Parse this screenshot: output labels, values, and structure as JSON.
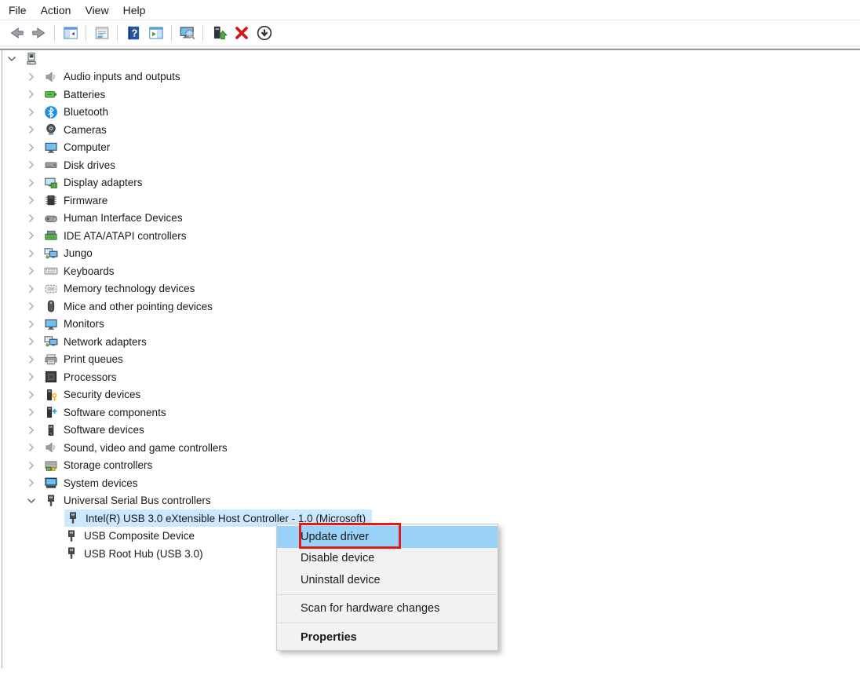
{
  "menubar": {
    "items": [
      {
        "label": "File"
      },
      {
        "label": "Action"
      },
      {
        "label": "View"
      },
      {
        "label": "Help"
      }
    ]
  },
  "toolbar": {
    "buttons": [
      {
        "type": "button",
        "name": "back",
        "icon": "back-arrow"
      },
      {
        "type": "button",
        "name": "forward",
        "icon": "forward-arrow"
      },
      {
        "type": "sep"
      },
      {
        "type": "button",
        "name": "show-console-tree",
        "icon": "console-tree"
      },
      {
        "type": "sep"
      },
      {
        "type": "button",
        "name": "properties",
        "icon": "properties-window"
      },
      {
        "type": "sep"
      },
      {
        "type": "button",
        "name": "help",
        "icon": "help-book"
      },
      {
        "type": "button",
        "name": "show-action-pane",
        "icon": "action-pane"
      },
      {
        "type": "sep"
      },
      {
        "type": "button",
        "name": "scan-for-hardware-changes",
        "icon": "scan-computer"
      },
      {
        "type": "sep"
      },
      {
        "type": "button",
        "name": "update-driver",
        "icon": "device-up-arrow"
      },
      {
        "type": "button",
        "name": "uninstall-device",
        "icon": "red-x"
      },
      {
        "type": "button",
        "name": "disable-device",
        "icon": "circle-down-arrow"
      }
    ]
  },
  "tree": {
    "rows": [
      {
        "label": "",
        "icon": "computer-root",
        "chevron": "down",
        "level": 0
      },
      {
        "label": "Audio inputs and outputs",
        "icon": "speaker",
        "chevron": "right",
        "level": 1
      },
      {
        "label": "Batteries",
        "icon": "battery",
        "chevron": "right",
        "level": 1
      },
      {
        "label": "Bluetooth",
        "icon": "bluetooth",
        "chevron": "right",
        "level": 1
      },
      {
        "label": "Cameras",
        "icon": "camera",
        "chevron": "right",
        "level": 1
      },
      {
        "label": "Computer",
        "icon": "monitor",
        "chevron": "right",
        "level": 1
      },
      {
        "label": "Disk drives",
        "icon": "disk",
        "chevron": "right",
        "level": 1
      },
      {
        "label": "Display adapters",
        "icon": "display-adapter",
        "chevron": "right",
        "level": 1
      },
      {
        "label": "Firmware",
        "icon": "firmware-chip",
        "chevron": "right",
        "level": 1
      },
      {
        "label": "Human Interface Devices",
        "icon": "gamepad",
        "chevron": "right",
        "level": 1
      },
      {
        "label": "IDE ATA/ATAPI controllers",
        "icon": "ide-board",
        "chevron": "right",
        "level": 1
      },
      {
        "label": "Jungo",
        "icon": "dual-monitors",
        "chevron": "right",
        "level": 1
      },
      {
        "label": "Keyboards",
        "icon": "keyboard",
        "chevron": "right",
        "level": 1
      },
      {
        "label": "Memory technology devices",
        "icon": "memory-card",
        "chevron": "right",
        "level": 1
      },
      {
        "label": "Mice and other pointing devices",
        "icon": "mouse",
        "chevron": "right",
        "level": 1
      },
      {
        "label": "Monitors",
        "icon": "monitor",
        "chevron": "right",
        "level": 1
      },
      {
        "label": "Network adapters",
        "icon": "dual-monitors",
        "chevron": "right",
        "level": 1
      },
      {
        "label": "Print queues",
        "icon": "printer",
        "chevron": "right",
        "level": 1
      },
      {
        "label": "Processors",
        "icon": "processor-chip",
        "chevron": "right",
        "level": 1
      },
      {
        "label": "Security devices",
        "icon": "security-key",
        "chevron": "right",
        "level": 1
      },
      {
        "label": "Software components",
        "icon": "software-component",
        "chevron": "right",
        "level": 1
      },
      {
        "label": "Software devices",
        "icon": "software-device",
        "chevron": "right",
        "level": 1
      },
      {
        "label": "Sound, video and game controllers",
        "icon": "speaker",
        "chevron": "right",
        "level": 1
      },
      {
        "label": "Storage controllers",
        "icon": "storage-board",
        "chevron": "right",
        "level": 1
      },
      {
        "label": "System devices",
        "icon": "system-board",
        "chevron": "right",
        "level": 1
      },
      {
        "label": "Universal Serial Bus controllers",
        "icon": "usb-plug",
        "chevron": "down",
        "level": 1
      },
      {
        "label": "Intel(R) USB 3.0 eXtensible Host Controller - 1.0 (Microsoft)",
        "icon": "usb-plug",
        "chevron": null,
        "level": 2,
        "selected": true
      },
      {
        "label": "USB Composite Device",
        "icon": "usb-plug",
        "chevron": null,
        "level": 2
      },
      {
        "label": "USB Root Hub (USB 3.0)",
        "icon": "usb-plug",
        "chevron": null,
        "level": 2
      }
    ]
  },
  "context_menu": {
    "items": [
      {
        "label": "Update driver",
        "highlighted": true,
        "annotated": true
      },
      {
        "label": "Disable device"
      },
      {
        "label": "Uninstall device"
      },
      {
        "type": "sep"
      },
      {
        "label": "Scan for hardware changes"
      },
      {
        "type": "sep"
      },
      {
        "label": "Properties",
        "bold": true
      }
    ]
  },
  "annotation": {
    "shape": "red-box",
    "target": "Update driver"
  },
  "colors": {
    "tree_selection": "#cce8ff",
    "menu_highlight": "#99d1f7",
    "annotation_red": "#e11b1b",
    "menu_background": "#f2f2f2"
  }
}
